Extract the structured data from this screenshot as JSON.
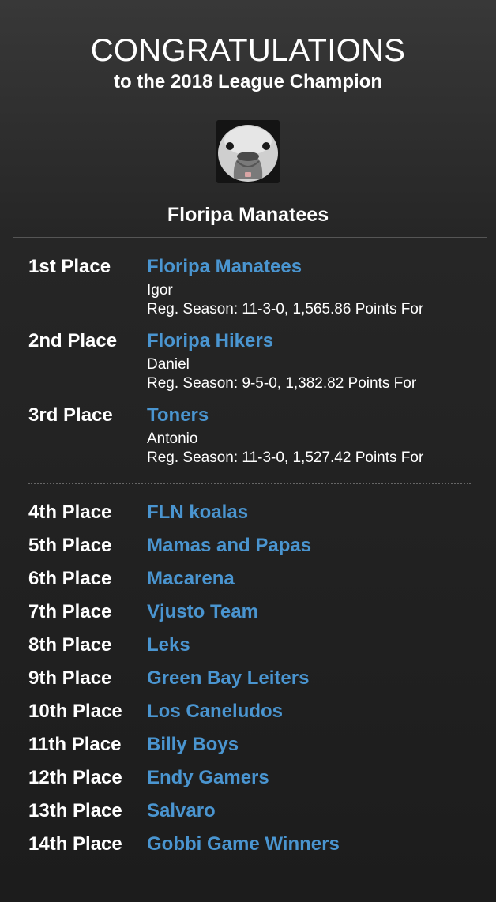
{
  "header": {
    "title": "CONGRATULATIONS",
    "subtitle": "to the 2018 League Champion",
    "champion_logo_icon": "manatee-face-icon",
    "champion_name": "Floripa Manatees"
  },
  "podium": [
    {
      "place": "1st Place",
      "team": "Floripa Manatees",
      "owner": "Igor",
      "record": "Reg. Season: 11-3-0, 1,565.86 Points For"
    },
    {
      "place": "2nd Place",
      "team": "Floripa Hikers",
      "owner": "Daniel",
      "record": "Reg. Season: 9-5-0, 1,382.82 Points For"
    },
    {
      "place": "3rd Place",
      "team": "Toners",
      "owner": "Antonio",
      "record": "Reg. Season: 11-3-0, 1,527.42 Points For"
    }
  ],
  "others": [
    {
      "place": "4th Place",
      "team": "FLN koalas"
    },
    {
      "place": "5th Place",
      "team": "Mamas and Papas"
    },
    {
      "place": "6th Place",
      "team": "Macarena"
    },
    {
      "place": "7th Place",
      "team": "Vjusto Team"
    },
    {
      "place": "8th Place",
      "team": "Leks"
    },
    {
      "place": "9th Place",
      "team": "Green Bay Leiters"
    },
    {
      "place": "10th Place",
      "team": "Los Caneludos"
    },
    {
      "place": "11th Place",
      "team": "Billy Boys"
    },
    {
      "place": "12th Place",
      "team": "Endy Gamers"
    },
    {
      "place": "13th Place",
      "team": "Salvaro"
    },
    {
      "place": "14th Place",
      "team": "Gobbi Game Winners"
    }
  ],
  "colors": {
    "link": "#4a95d0",
    "text": "#ffffff",
    "background_top": "#383838",
    "background_bottom": "#1c1c1c"
  }
}
